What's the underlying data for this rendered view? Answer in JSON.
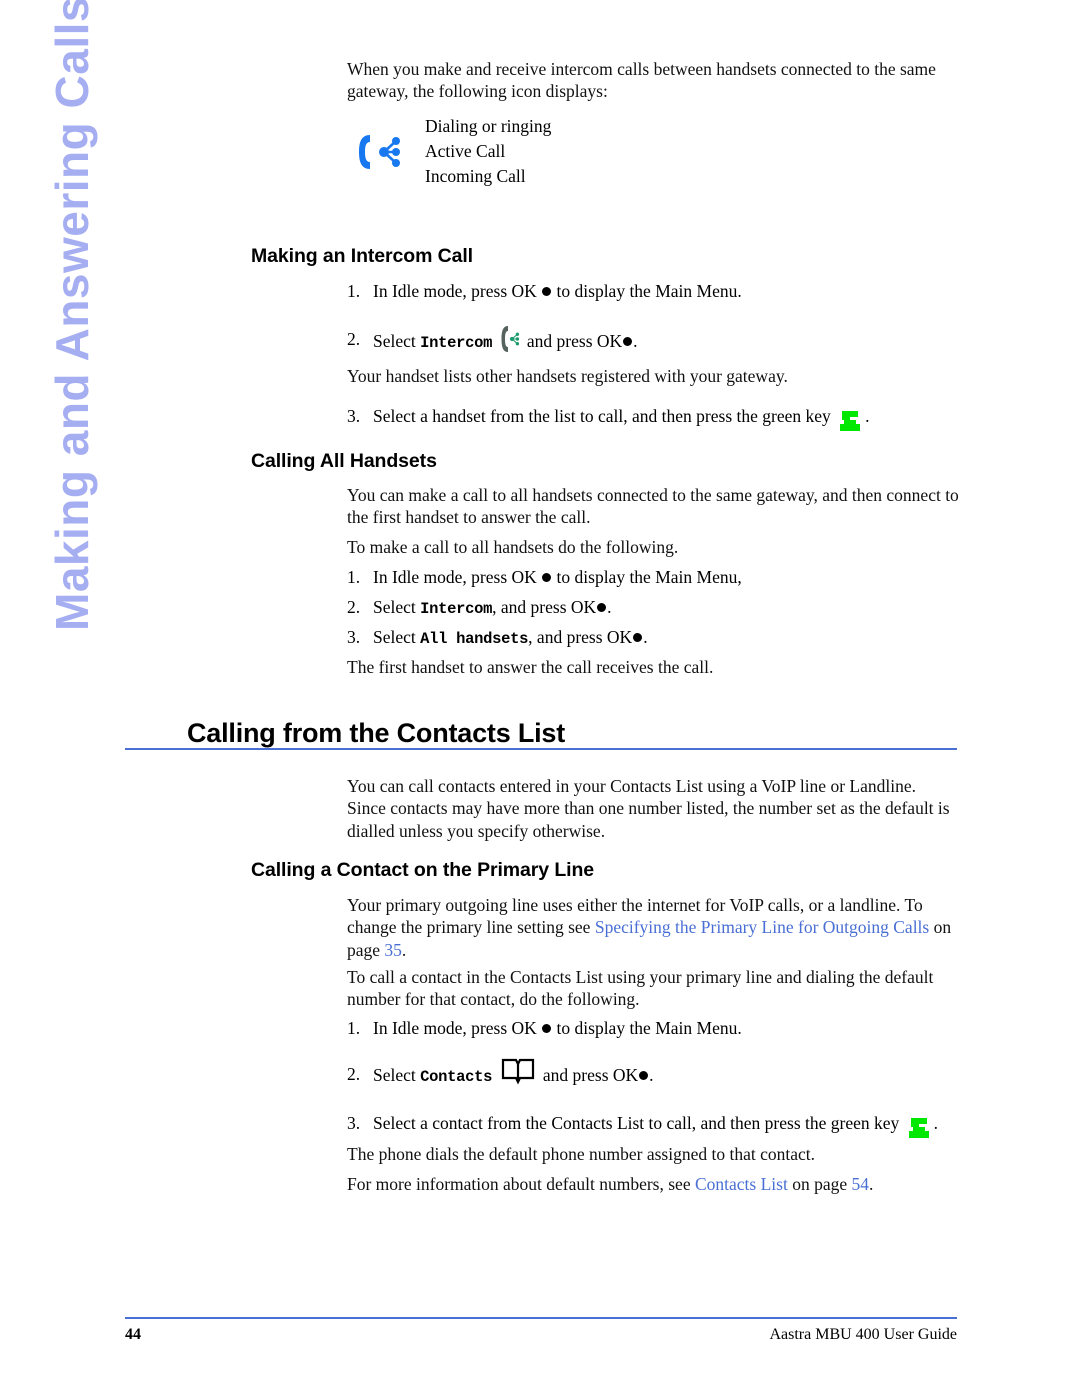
{
  "page": {
    "sidebar_chapter": "Making and Answering Calls",
    "footer_page_number": "44",
    "footer_guide_title": "Aastra MBU 400 User Guide",
    "accent_blue": "#4a6fd4",
    "sidebar_color": "#a6aef2",
    "icon_blue": "#1878f0",
    "green_key_color": "#00e800"
  },
  "intro": {
    "paragraph": "When you make and receive intercom calls between handsets connected to the same gateway, the following icon displays:",
    "icon_name": "intercom-icon",
    "captions": [
      "Dialing or ringing",
      "Active Call",
      "Incoming Call"
    ]
  },
  "making_intercom_call": {
    "heading": "Making an Intercom Call",
    "step1_num": "1.",
    "step1_a": "In Idle mode, press OK",
    "step1_b": "to display the Main Menu.",
    "step2_num": "2.",
    "step2_a": "Select",
    "step2_menu": "Intercom",
    "step2_b": "and press OK",
    "step2_c": ".",
    "note": "Your handset lists other handsets registered with your gateway.",
    "step3_num": "3.",
    "step3_a": "Select a handset from the list to call, and then press the green key",
    "step3_b": "."
  },
  "calling_all_handsets": {
    "heading": "Calling All Handsets",
    "para1": "You can make a call to all handsets connected to the same gateway, and then connect to the first handset to answer the call.",
    "para2": "To make a call to all handsets do the following.",
    "step1_num": "1.",
    "step1_a": "In Idle mode, press OK",
    "step1_b": "to display the Main Menu,",
    "step2_num": "2.",
    "step2_a": "Select",
    "step2_menu": "Intercom",
    "step2_b": ", and press OK",
    "step2_c": ".",
    "step3_num": "3.",
    "step3_a": "Select",
    "step3_menu": "All handsets",
    "step3_b": ", and press OK",
    "step3_c": ".",
    "note": "The first handset to answer the call receives the call."
  },
  "contacts_list_chapter": {
    "heading": "Calling from the Contacts List",
    "para": "You can call contacts entered in your Contacts List using a VoIP line or Landline. Since contacts may have more than one number listed, the number set as the default is dialled unless you specify otherwise."
  },
  "primary_line": {
    "heading": "Calling a Contact on the Primary Line",
    "para1_a": "Your primary outgoing line uses either the internet for VoIP calls, or a landline. To change the primary line setting see",
    "para1_link": "Specifying the Primary Line for Outgoing Calls",
    "para1_b": "on page",
    "para1_page": "35",
    "para1_c": ".",
    "para2": "To call a contact in the Contacts List using your primary line and dialing the default number for that contact, do the following.",
    "step1_num": "1.",
    "step1_a": "In Idle mode, press OK",
    "step1_b": "to display the Main Menu.",
    "step2_num": "2.",
    "step2_a": "Select",
    "step2_menu": "Contacts",
    "step2_b": "and press OK",
    "step2_c": ".",
    "step3_num": "3.",
    "step3_a": "Select a contact from the Contacts List to call, and then press the green key",
    "step3_b": ".",
    "note1": "The phone dials the default phone number assigned to that contact.",
    "note2_a": "For more information about default numbers, see",
    "note2_link": "Contacts List",
    "note2_b": "on page",
    "note2_page": "54",
    "note2_c": "."
  }
}
